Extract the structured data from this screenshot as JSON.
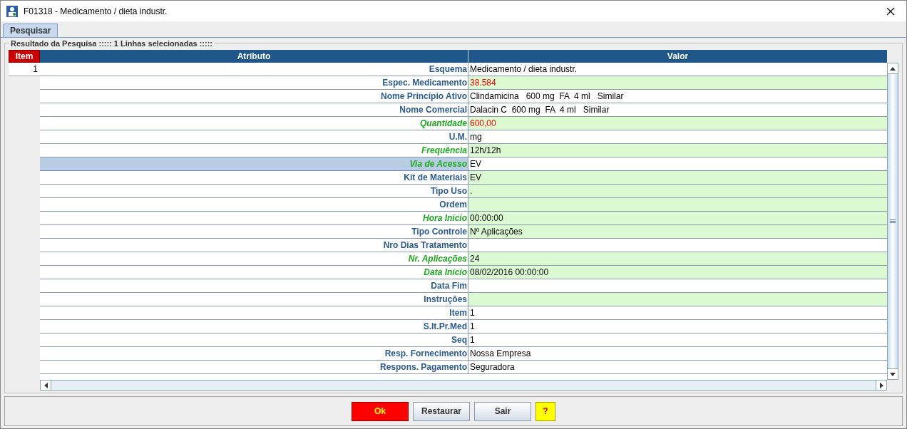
{
  "window": {
    "title": "F01318 - Medicamento / dieta industr."
  },
  "tabs": [
    {
      "label": "Pesquisar",
      "selected": true
    }
  ],
  "group": {
    "title": "Resultado da Pesquisa ::::: 1 Linhas selecionadas :::::"
  },
  "table": {
    "columns": [
      "Item",
      "Atributo",
      "Valor"
    ],
    "item_rows": [
      {
        "label": "1",
        "selected": false
      }
    ],
    "rows": [
      {
        "attribute": "Esquema",
        "value": "Medicamento / dieta industr.",
        "required": false,
        "editable": false,
        "alert": false,
        "selected": false
      },
      {
        "attribute": "Espec. Medicamento",
        "value": "38.584",
        "required": false,
        "editable": true,
        "alert": true,
        "selected": false
      },
      {
        "attribute": "Nome Princípio Ativo",
        "value": "Clindamicina   600 mg  FA  4 ml   Similar",
        "required": false,
        "editable": false,
        "alert": false,
        "selected": false
      },
      {
        "attribute": "Nome Comercial",
        "value": "Dalacin C  600 mg  FA  4 ml   Similar",
        "required": false,
        "editable": false,
        "alert": false,
        "selected": false
      },
      {
        "attribute": "Quantidade",
        "value": "600,00",
        "required": true,
        "editable": true,
        "alert": true,
        "selected": false
      },
      {
        "attribute": "U.M.",
        "value": "mg",
        "required": false,
        "editable": false,
        "alert": false,
        "selected": false
      },
      {
        "attribute": "Frequência",
        "value": "12h/12h",
        "required": true,
        "editable": true,
        "alert": false,
        "selected": false
      },
      {
        "attribute": "Via de Acesso",
        "value": "EV",
        "required": true,
        "editable": false,
        "alert": false,
        "selected": true
      },
      {
        "attribute": "Kit de Materiais",
        "value": "EV",
        "required": false,
        "editable": true,
        "alert": false,
        "selected": false
      },
      {
        "attribute": "Tipo Uso",
        "value": ".",
        "required": false,
        "editable": true,
        "alert": false,
        "selected": false
      },
      {
        "attribute": "Ordem",
        "value": "",
        "required": false,
        "editable": true,
        "alert": false,
        "selected": false
      },
      {
        "attribute": "Hora Início",
        "value": "00:00:00",
        "required": true,
        "editable": true,
        "alert": false,
        "selected": false
      },
      {
        "attribute": "Tipo Controle",
        "value": "Nº Aplicações",
        "required": false,
        "editable": true,
        "alert": false,
        "selected": false
      },
      {
        "attribute": "Nro Dias Tratamento",
        "value": "",
        "required": false,
        "editable": false,
        "alert": false,
        "selected": false
      },
      {
        "attribute": "Nr. Aplicações",
        "value": "24",
        "required": true,
        "editable": true,
        "alert": false,
        "selected": false
      },
      {
        "attribute": "Data Início",
        "value": "08/02/2016 00:00:00",
        "required": true,
        "editable": true,
        "alert": false,
        "selected": false
      },
      {
        "attribute": "Data Fim",
        "value": "",
        "required": false,
        "editable": false,
        "alert": false,
        "selected": false
      },
      {
        "attribute": "Instruções",
        "value": "",
        "required": false,
        "editable": true,
        "alert": false,
        "selected": false
      },
      {
        "attribute": "Item",
        "value": "1",
        "required": false,
        "editable": false,
        "alert": false,
        "selected": false
      },
      {
        "attribute": "S.It.Pr.Med",
        "value": "1",
        "required": false,
        "editable": false,
        "alert": false,
        "selected": false
      },
      {
        "attribute": "Seq",
        "value": "1",
        "required": false,
        "editable": false,
        "alert": false,
        "selected": false
      },
      {
        "attribute": "Resp. Fornecimento",
        "value": "Nossa Empresa",
        "required": false,
        "editable": false,
        "alert": false,
        "selected": false
      },
      {
        "attribute": "Respons. Pagamento",
        "value": "Seguradora",
        "required": false,
        "editable": false,
        "alert": false,
        "selected": false
      }
    ]
  },
  "buttons": [
    {
      "label": "Ok",
      "kind": "primary"
    },
    {
      "label": "Restaurar",
      "kind": "normal"
    },
    {
      "label": "Sair",
      "kind": "normal"
    },
    {
      "label": "?",
      "kind": "help"
    }
  ]
}
